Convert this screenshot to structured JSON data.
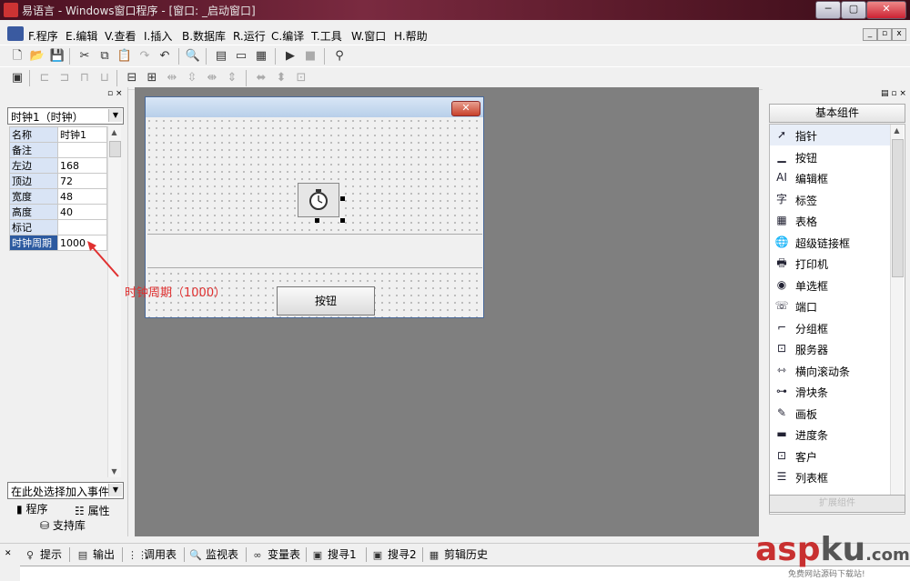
{
  "window": {
    "title": "易语言 - Windows窗口程序 - [窗口: _启动窗口]",
    "min": "─",
    "max": "▢",
    "close": "✕"
  },
  "menu": {
    "items": [
      "F.程序",
      "E.编辑",
      "V.查看",
      "I.插入",
      "B.数据库",
      "R.运行",
      "C.编译",
      "T.工具",
      "W.窗口",
      "H.帮助"
    ],
    "mdi": [
      "_",
      "▫",
      "x"
    ]
  },
  "left_panel": {
    "object_combo": "时钟1（时钟）",
    "properties": [
      {
        "key": "名称",
        "value": "时钟1"
      },
      {
        "key": "备注",
        "value": ""
      },
      {
        "key": "左边",
        "value": "168"
      },
      {
        "key": "顶边",
        "value": "72"
      },
      {
        "key": "宽度",
        "value": "48"
      },
      {
        "key": "高度",
        "value": "40"
      },
      {
        "key": "标记",
        "value": ""
      },
      {
        "key": "时钟周期",
        "value": "1000"
      }
    ],
    "event_combo": "在此处选择加入事件",
    "tab_program": "程序",
    "tab_property": "属性",
    "tab_support": "支持库"
  },
  "design": {
    "button_label": "按钮",
    "annotation": "时钟周期（1000）"
  },
  "right_panel": {
    "header": "基本组件",
    "components": [
      {
        "label": "指针",
        "icon": "pointer-icon"
      },
      {
        "label": "按钮",
        "icon": "button-icon"
      },
      {
        "label": "编辑框",
        "icon": "editbox-icon"
      },
      {
        "label": "标签",
        "icon": "label-icon"
      },
      {
        "label": "表格",
        "icon": "table-icon"
      },
      {
        "label": "超级链接框",
        "icon": "hyperlink-icon"
      },
      {
        "label": "打印机",
        "icon": "printer-icon"
      },
      {
        "label": "单选框",
        "icon": "radio-icon"
      },
      {
        "label": "端口",
        "icon": "port-icon"
      },
      {
        "label": "分组框",
        "icon": "groupbox-icon"
      },
      {
        "label": "服务器",
        "icon": "server-icon"
      },
      {
        "label": "横向滚动条",
        "icon": "hscroll-icon"
      },
      {
        "label": "滑块条",
        "icon": "slider-icon"
      },
      {
        "label": "画板",
        "icon": "canvas-icon"
      },
      {
        "label": "进度条",
        "icon": "progress-icon"
      },
      {
        "label": "客户",
        "icon": "client-icon"
      },
      {
        "label": "列表框",
        "icon": "listbox-icon"
      }
    ],
    "bottom_label": "扩展组件"
  },
  "bottom_tabs": [
    "提示",
    "输出",
    "调用表",
    "监视表",
    "变量表",
    "搜寻1",
    "搜寻2",
    "剪辑历史"
  ],
  "watermark": {
    "asp": "asp",
    "ku": "ku",
    "com": ".com",
    "sub": "免费网站源码下载站!"
  },
  "colors": {
    "selected_property": "#2c5aa0",
    "annotation": "#e03030",
    "design_bg": "#7f7f7f"
  }
}
